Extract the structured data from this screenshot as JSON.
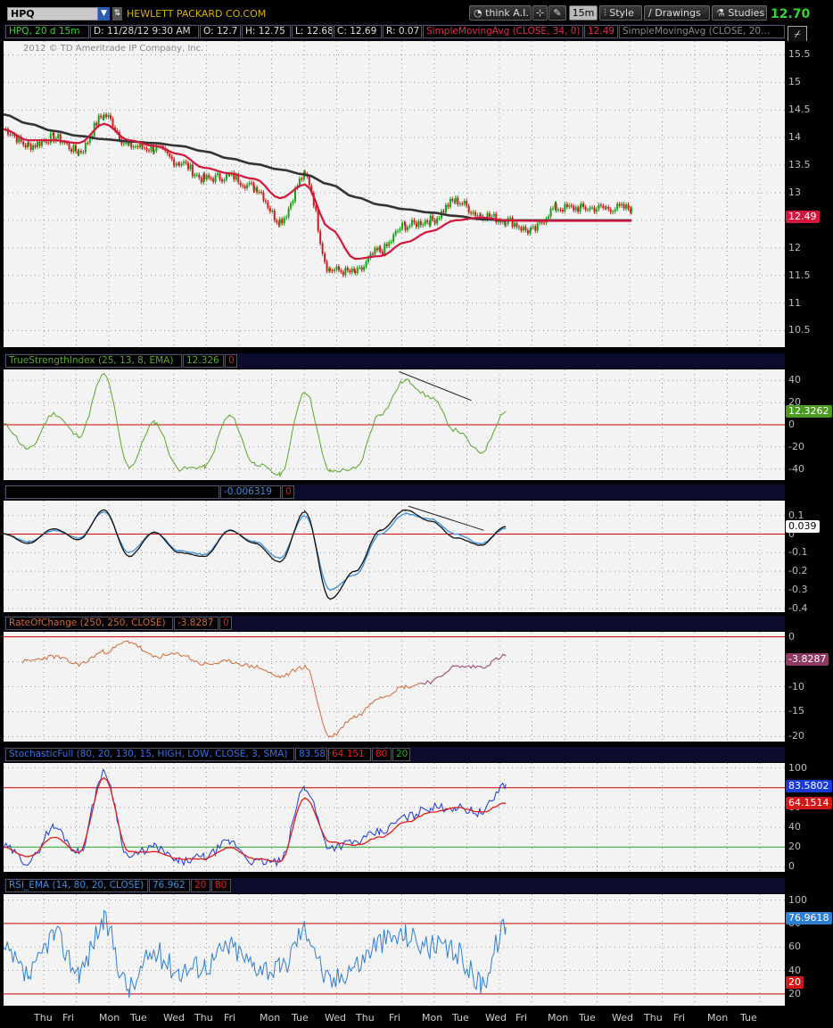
{
  "toolbar": {
    "symbol": "HPQ",
    "company": "HEWLETT PACKARD CO.COM",
    "think_ai": "think A.I.",
    "interval": "15m",
    "style": "Style",
    "drawings": "Drawings",
    "studies": "Studies",
    "last_price": "12.70"
  },
  "price_header": {
    "symbol_period": "HPQ, 20 d 15m",
    "date": "D: 11/28/12 9:30 AM",
    "open": "O: 12.7",
    "high": "H: 12.75",
    "low": "L: 12.68",
    "close": "C: 12.69",
    "range": "R: 0.07",
    "sma1": "SimpleMovingAvg (CLOSE, 34, 0)",
    "sma1_val": "12.49",
    "sma2": "SimpleMovingAvg (CLOSE, 20..."
  },
  "copyright": "2012 © TD Ameritrade IP Company, Inc.",
  "tsi_header": {
    "name": "TrueStrengthIndex (25, 13, 8, EMA)",
    "val": "12.326",
    "zero": "0"
  },
  "macd_header": {
    "val": "-0.006319",
    "zero": "0"
  },
  "roc_header": {
    "name": "RateOfChange (250, 250, CLOSE)",
    "val": "-3.8287",
    "zero": "0"
  },
  "stoch_header": {
    "name": "StochasticFull (80, 20, 130, 15, HIGH, LOW, CLOSE, 3, SMA)",
    "k": "83.58",
    "d": "64.151",
    "ob": "80",
    "os": "20"
  },
  "rsi_header": {
    "name": "RSI_EMA (14, 80, 20, CLOSE)",
    "val": "76.962",
    "os": "20",
    "ob": "80"
  },
  "badges": {
    "price": "12.49",
    "tsi": "12.3262",
    "macd": "0.039",
    "roc": "-3.8287",
    "stoch_k": "83.5802",
    "stoch_d": "64.1514",
    "rsi": "76.9618",
    "rsi_os": "20"
  },
  "x_axis_labels": [
    "Thu",
    "Fri",
    "Mon",
    "Tue",
    "Wed",
    "Thu",
    "Fri",
    "Mon",
    "Tue",
    "Wed",
    "Thu",
    "Fri",
    "Mon",
    "Tue",
    "Wed",
    "Fri",
    "Mon",
    "Tue",
    "Wed",
    "Thu",
    "Fri",
    "Mon",
    "Tue"
  ],
  "colors": {
    "candle_up": "#14a314",
    "candle_down": "#c81f1f",
    "sma34": "#d2163c",
    "sma20": "#6fb23a",
    "sma_long": "#333333",
    "tsi": "#5aa62d",
    "macd": "#111111",
    "macd_signal": "#3a8ed8",
    "roc": "#d26a3a",
    "stoch_k": "#1a3ad6",
    "stoch_d": "#e01c1c",
    "rsi": "#2f7fd0",
    "ref_line": "#d00000",
    "ref_green": "#2aa82a"
  },
  "chart_data": [
    {
      "type": "line",
      "id": "price",
      "ylim": [
        10.2,
        15.75
      ],
      "yticks": [
        10.5,
        11,
        11.5,
        12,
        12.5,
        13,
        13.5,
        14,
        14.5,
        15,
        15.5
      ],
      "x": [
        0,
        4,
        8,
        12,
        16,
        20,
        24,
        28,
        32,
        36,
        40,
        44,
        48,
        52,
        56,
        60,
        64,
        68,
        72,
        76,
        80,
        84,
        88,
        92,
        96,
        100
      ],
      "series": [
        {
          "name": "Close",
          "values": [
            14.15,
            13.85,
            14.0,
            13.75,
            14.4,
            13.85,
            13.8,
            13.55,
            13.25,
            13.3,
            13.1,
            12.5,
            13.3,
            11.6,
            11.55,
            11.95,
            12.4,
            12.5,
            12.85,
            12.6,
            12.5,
            12.3,
            12.72,
            12.72,
            12.72,
            12.72
          ]
        },
        {
          "name": "SimpleMovingAvg (CLOSE, 34, 0)",
          "values": [
            14.15,
            13.95,
            13.95,
            13.9,
            14.25,
            13.95,
            13.85,
            13.7,
            13.45,
            13.35,
            13.25,
            12.9,
            13.15,
            12.35,
            11.8,
            11.85,
            12.1,
            12.3,
            12.5,
            12.55,
            12.5,
            12.49,
            12.49,
            12.49,
            12.49,
            12.49
          ]
        },
        {
          "name": "SimpleMovingAvg (CLOSE, 20...",
          "values": [
            14.42,
            14.25,
            14.12,
            14.03,
            13.97,
            13.93,
            13.9,
            13.85,
            13.75,
            13.62,
            13.52,
            13.42,
            13.33,
            13.15,
            12.92,
            12.78,
            12.7,
            12.64,
            12.58,
            12.52,
            12.5,
            12.5,
            12.5,
            12.5,
            12.5,
            12.5
          ]
        }
      ]
    },
    {
      "type": "line",
      "id": "tsi",
      "ylim": [
        -50,
        50
      ],
      "yticks": [
        -40,
        -20,
        0,
        20,
        40
      ],
      "x": [
        0,
        4,
        8,
        12,
        16,
        20,
        24,
        28,
        32,
        36,
        40,
        44,
        48,
        52,
        56,
        60,
        64,
        68,
        72,
        76,
        80
      ],
      "series": [
        {
          "name": "TSI",
          "values": [
            0,
            -22,
            10,
            -10,
            45,
            -38,
            2,
            -40,
            -38,
            8,
            -35,
            -45,
            30,
            -42,
            -40,
            10,
            40,
            25,
            -5,
            -25,
            12.3
          ]
        }
      ]
    },
    {
      "type": "line",
      "id": "macd",
      "ylim": [
        -0.42,
        0.18
      ],
      "yticks": [
        0.1,
        0,
        -0.1,
        -0.2,
        -0.3,
        -0.4
      ],
      "x": [
        0,
        4,
        8,
        12,
        16,
        20,
        24,
        28,
        32,
        36,
        40,
        44,
        48,
        52,
        56,
        60,
        64,
        68,
        72,
        76,
        80
      ],
      "series": [
        {
          "name": "MACD",
          "values": [
            0,
            -0.05,
            0.03,
            -0.03,
            0.13,
            -0.12,
            0.01,
            -0.1,
            -0.12,
            0.02,
            -0.05,
            -0.15,
            0.12,
            -0.35,
            -0.2,
            0.02,
            0.13,
            0.07,
            -0.02,
            -0.06,
            0.04
          ]
        },
        {
          "name": "Signal",
          "values": [
            0,
            -0.04,
            0.02,
            -0.02,
            0.12,
            -0.1,
            0.01,
            -0.09,
            -0.11,
            0.02,
            -0.04,
            -0.13,
            0.1,
            -0.3,
            -0.22,
            0.0,
            0.11,
            0.08,
            0.0,
            -0.05,
            0.03
          ]
        }
      ]
    },
    {
      "type": "line",
      "id": "roc",
      "ylim": [
        -21,
        1
      ],
      "yticks": [
        0,
        -5,
        -10,
        -15,
        -20
      ],
      "x": [
        3,
        8,
        12,
        16,
        20,
        24,
        28,
        32,
        36,
        40,
        44,
        48,
        52,
        56,
        60,
        64,
        68,
        72,
        76,
        80
      ],
      "series": [
        {
          "name": "ROC",
          "values": [
            -5,
            -4,
            -5.5,
            -3,
            -1,
            -4,
            -3.5,
            -5.5,
            -5,
            -6,
            -8,
            -6,
            -20,
            -16,
            -12,
            -10,
            -9,
            -6,
            -6,
            -3.83
          ]
        }
      ]
    },
    {
      "type": "line",
      "id": "stoch",
      "ylim": [
        -5,
        105
      ],
      "yticks": [
        100,
        80,
        60,
        40,
        20,
        0
      ],
      "x": [
        0,
        4,
        8,
        12,
        16,
        20,
        24,
        28,
        32,
        36,
        40,
        44,
        48,
        52,
        56,
        60,
        64,
        68,
        72,
        76,
        80
      ],
      "series": [
        {
          "name": "%K",
          "values": [
            20,
            5,
            40,
            15,
            95,
            10,
            20,
            5,
            10,
            25,
            5,
            5,
            80,
            20,
            25,
            35,
            50,
            60,
            60,
            55,
            83.58
          ]
        },
        {
          "name": "%D",
          "values": [
            20,
            10,
            30,
            15,
            90,
            15,
            15,
            8,
            8,
            20,
            8,
            5,
            70,
            25,
            22,
            30,
            45,
            55,
            60,
            55,
            64.15
          ]
        }
      ],
      "ref_lines": [
        80,
        20
      ]
    },
    {
      "type": "line",
      "id": "rsi",
      "ylim": [
        10,
        105
      ],
      "yticks": [
        100,
        80,
        60,
        40,
        20
      ],
      "x": [
        0,
        4,
        8,
        12,
        16,
        20,
        24,
        28,
        32,
        36,
        40,
        44,
        48,
        52,
        56,
        60,
        64,
        68,
        72,
        76,
        80
      ],
      "series": [
        {
          "name": "RSI_EMA",
          "values": [
            55,
            35,
            70,
            40,
            80,
            25,
            55,
            40,
            45,
            60,
            45,
            40,
            75,
            30,
            45,
            65,
            70,
            60,
            55,
            30,
            76.96
          ]
        }
      ],
      "ref_lines": [
        80,
        20
      ]
    }
  ]
}
